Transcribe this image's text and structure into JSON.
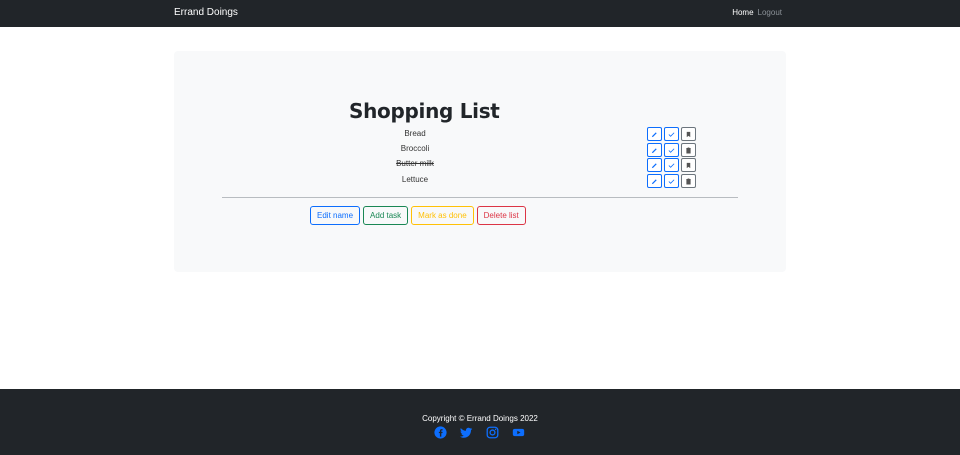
{
  "nav": {
    "brand": "Errand Doings",
    "home": "Home",
    "logout": "Logout"
  },
  "list": {
    "title": "Shopping List",
    "tasks": [
      {
        "name": "Bread",
        "done": false
      },
      {
        "name": "Broccoli",
        "done": false
      },
      {
        "name": "Butter milk",
        "done": true
      },
      {
        "name": "Lettuce",
        "done": false
      }
    ]
  },
  "buttons": {
    "edit_name": "Edit name",
    "add_task": "Add task",
    "mark_done": "Mark as done",
    "delete_list": "Delete list"
  },
  "footer": {
    "copyright": "Copyright © Errand Doings 2022"
  },
  "icons": {
    "edit": "pencil-icon",
    "check": "check-icon",
    "tag": "bookmark-icon",
    "trash": "trash-icon",
    "facebook": "facebook-icon",
    "twitter": "twitter-icon",
    "instagram": "instagram-icon",
    "youtube": "youtube-icon"
  },
  "colors": {
    "primary": "#0d6efd",
    "success": "#198754",
    "warning": "#ffc107",
    "danger": "#dc3545",
    "dark": "#212529",
    "light": "#f8f9fa"
  }
}
